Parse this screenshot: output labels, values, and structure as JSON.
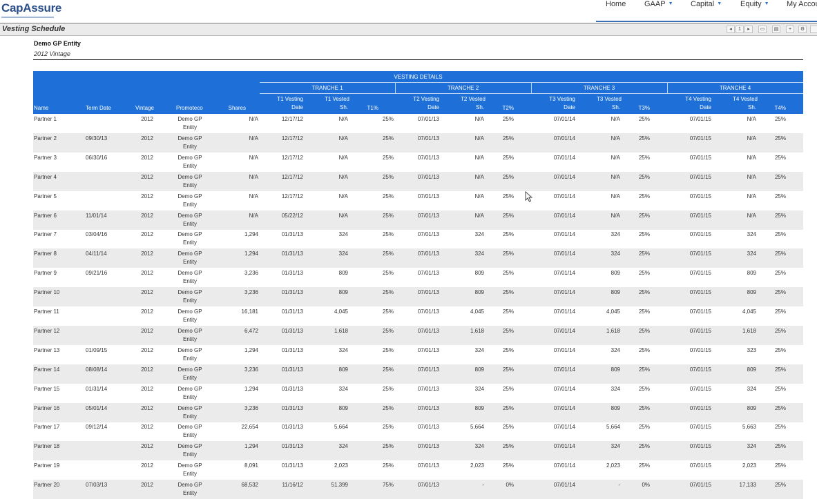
{
  "app": {
    "logo": "CapAssure"
  },
  "nav": [
    {
      "label": "Home",
      "dropdown": false
    },
    {
      "label": "GAAP",
      "dropdown": true
    },
    {
      "label": "Capital",
      "dropdown": true
    },
    {
      "label": "Equity",
      "dropdown": true
    },
    {
      "label": "My Accou",
      "dropdown": false
    }
  ],
  "report": {
    "title": "Vesting Schedule",
    "entity": "Demo GP Entity",
    "vintage_label": "2012 Vintage",
    "toolbar": {
      "first": "◂",
      "page": "1",
      "next": "▸",
      "print": "▭",
      "export": "▤",
      "zoom": "+",
      "settings": "⚙"
    }
  },
  "table": {
    "group_header": "VESTING DETAILS",
    "tranches": [
      "TRANCHE 1",
      "TRANCHE 2",
      "TRANCHE 3",
      "TRANCHE 4"
    ],
    "columns": {
      "name": "Name",
      "term": "Term Date",
      "vintage": "Vintage",
      "promoteco": "Promoteco",
      "shares": "Shares",
      "t1_date": [
        "T1 Vesting",
        "Date"
      ],
      "t1_sh": [
        "T1 Vested",
        "Sh."
      ],
      "t1_pct": "T1%",
      "t2_date": [
        "T2 Vesting",
        "Date"
      ],
      "t2_sh": [
        "T2 Vested",
        "Sh."
      ],
      "t2_pct": "T2%",
      "t3_date": [
        "T3 Vesting",
        "Date"
      ],
      "t3_sh": [
        "T3 Vested",
        "Sh."
      ],
      "t3_pct": "T3%",
      "t4_date": [
        "T4 Vesting",
        "Date"
      ],
      "t4_sh": [
        "T4 Vested",
        "Sh."
      ],
      "t4_pct": "T4%"
    },
    "promoteco_lines": [
      "Demo GP",
      "Entity"
    ],
    "rows": [
      {
        "name": "Partner 1",
        "term": "",
        "vintage": "2012",
        "shares": "N/A",
        "t1_date": "12/17/12",
        "t1_sh": "N/A",
        "t1_pct": "25%",
        "t2_date": "07/01/13",
        "t2_sh": "N/A",
        "t2_pct": "25%",
        "t3_date": "07/01/14",
        "t3_sh": "N/A",
        "t3_pct": "25%",
        "t4_date": "07/01/15",
        "t4_sh": "N/A",
        "t4_pct": "25%"
      },
      {
        "name": "Partner 2",
        "term": "09/30/13",
        "vintage": "2012",
        "shares": "N/A",
        "t1_date": "12/17/12",
        "t1_sh": "N/A",
        "t1_pct": "25%",
        "t2_date": "07/01/13",
        "t2_sh": "N/A",
        "t2_pct": "25%",
        "t3_date": "07/01/14",
        "t3_sh": "N/A",
        "t3_pct": "25%",
        "t4_date": "07/01/15",
        "t4_sh": "N/A",
        "t4_pct": "25%"
      },
      {
        "name": "Partner 3",
        "term": "06/30/16",
        "vintage": "2012",
        "shares": "N/A",
        "t1_date": "12/17/12",
        "t1_sh": "N/A",
        "t1_pct": "25%",
        "t2_date": "07/01/13",
        "t2_sh": "N/A",
        "t2_pct": "25%",
        "t3_date": "07/01/14",
        "t3_sh": "N/A",
        "t3_pct": "25%",
        "t4_date": "07/01/15",
        "t4_sh": "N/A",
        "t4_pct": "25%"
      },
      {
        "name": "Partner 4",
        "term": "",
        "vintage": "2012",
        "shares": "N/A",
        "t1_date": "12/17/12",
        "t1_sh": "N/A",
        "t1_pct": "25%",
        "t2_date": "07/01/13",
        "t2_sh": "N/A",
        "t2_pct": "25%",
        "t3_date": "07/01/14",
        "t3_sh": "N/A",
        "t3_pct": "25%",
        "t4_date": "07/01/15",
        "t4_sh": "N/A",
        "t4_pct": "25%"
      },
      {
        "name": "Partner 5",
        "term": "",
        "vintage": "2012",
        "shares": "N/A",
        "t1_date": "12/17/12",
        "t1_sh": "N/A",
        "t1_pct": "25%",
        "t2_date": "07/01/13",
        "t2_sh": "N/A",
        "t2_pct": "25%",
        "t3_date": "07/01/14",
        "t3_sh": "N/A",
        "t3_pct": "25%",
        "t4_date": "07/01/15",
        "t4_sh": "N/A",
        "t4_pct": "25%"
      },
      {
        "name": "Partner 6",
        "term": "11/01/14",
        "vintage": "2012",
        "shares": "N/A",
        "t1_date": "05/22/12",
        "t1_sh": "N/A",
        "t1_pct": "25%",
        "t2_date": "07/01/13",
        "t2_sh": "N/A",
        "t2_pct": "25%",
        "t3_date": "07/01/14",
        "t3_sh": "N/A",
        "t3_pct": "25%",
        "t4_date": "07/01/15",
        "t4_sh": "N/A",
        "t4_pct": "25%"
      },
      {
        "name": "Partner 7",
        "term": "03/04/16",
        "vintage": "2012",
        "shares": "1,294",
        "t1_date": "01/31/13",
        "t1_sh": "324",
        "t1_pct": "25%",
        "t2_date": "07/01/13",
        "t2_sh": "324",
        "t2_pct": "25%",
        "t3_date": "07/01/14",
        "t3_sh": "324",
        "t3_pct": "25%",
        "t4_date": "07/01/15",
        "t4_sh": "324",
        "t4_pct": "25%"
      },
      {
        "name": "Partner 8",
        "term": "04/11/14",
        "vintage": "2012",
        "shares": "1,294",
        "t1_date": "01/31/13",
        "t1_sh": "324",
        "t1_pct": "25%",
        "t2_date": "07/01/13",
        "t2_sh": "324",
        "t2_pct": "25%",
        "t3_date": "07/01/14",
        "t3_sh": "324",
        "t3_pct": "25%",
        "t4_date": "07/01/15",
        "t4_sh": "324",
        "t4_pct": "25%"
      },
      {
        "name": "Partner 9",
        "term": "09/21/16",
        "vintage": "2012",
        "shares": "3,236",
        "t1_date": "01/31/13",
        "t1_sh": "809",
        "t1_pct": "25%",
        "t2_date": "07/01/13",
        "t2_sh": "809",
        "t2_pct": "25%",
        "t3_date": "07/01/14",
        "t3_sh": "809",
        "t3_pct": "25%",
        "t4_date": "07/01/15",
        "t4_sh": "809",
        "t4_pct": "25%"
      },
      {
        "name": "Partner 10",
        "term": "",
        "vintage": "2012",
        "shares": "3,236",
        "t1_date": "01/31/13",
        "t1_sh": "809",
        "t1_pct": "25%",
        "t2_date": "07/01/13",
        "t2_sh": "809",
        "t2_pct": "25%",
        "t3_date": "07/01/14",
        "t3_sh": "809",
        "t3_pct": "25%",
        "t4_date": "07/01/15",
        "t4_sh": "809",
        "t4_pct": "25%"
      },
      {
        "name": "Partner 11",
        "term": "",
        "vintage": "2012",
        "shares": "16,181",
        "t1_date": "01/31/13",
        "t1_sh": "4,045",
        "t1_pct": "25%",
        "t2_date": "07/01/13",
        "t2_sh": "4,045",
        "t2_pct": "25%",
        "t3_date": "07/01/14",
        "t3_sh": "4,045",
        "t3_pct": "25%",
        "t4_date": "07/01/15",
        "t4_sh": "4,045",
        "t4_pct": "25%"
      },
      {
        "name": "Partner 12",
        "term": "",
        "vintage": "2012",
        "shares": "6,472",
        "t1_date": "01/31/13",
        "t1_sh": "1,618",
        "t1_pct": "25%",
        "t2_date": "07/01/13",
        "t2_sh": "1,618",
        "t2_pct": "25%",
        "t3_date": "07/01/14",
        "t3_sh": "1,618",
        "t3_pct": "25%",
        "t4_date": "07/01/15",
        "t4_sh": "1,618",
        "t4_pct": "25%"
      },
      {
        "name": "Partner 13",
        "term": "01/09/15",
        "vintage": "2012",
        "shares": "1,294",
        "t1_date": "01/31/13",
        "t1_sh": "324",
        "t1_pct": "25%",
        "t2_date": "07/01/13",
        "t2_sh": "324",
        "t2_pct": "25%",
        "t3_date": "07/01/14",
        "t3_sh": "324",
        "t3_pct": "25%",
        "t4_date": "07/01/15",
        "t4_sh": "323",
        "t4_pct": "25%"
      },
      {
        "name": "Partner 14",
        "term": "08/08/14",
        "vintage": "2012",
        "shares": "3,236",
        "t1_date": "01/31/13",
        "t1_sh": "809",
        "t1_pct": "25%",
        "t2_date": "07/01/13",
        "t2_sh": "809",
        "t2_pct": "25%",
        "t3_date": "07/01/14",
        "t3_sh": "809",
        "t3_pct": "25%",
        "t4_date": "07/01/15",
        "t4_sh": "809",
        "t4_pct": "25%"
      },
      {
        "name": "Partner 15",
        "term": "01/31/14",
        "vintage": "2012",
        "shares": "1,294",
        "t1_date": "01/31/13",
        "t1_sh": "324",
        "t1_pct": "25%",
        "t2_date": "07/01/13",
        "t2_sh": "324",
        "t2_pct": "25%",
        "t3_date": "07/01/14",
        "t3_sh": "324",
        "t3_pct": "25%",
        "t4_date": "07/01/15",
        "t4_sh": "324",
        "t4_pct": "25%"
      },
      {
        "name": "Partner 16",
        "term": "05/01/14",
        "vintage": "2012",
        "shares": "3,236",
        "t1_date": "01/31/13",
        "t1_sh": "809",
        "t1_pct": "25%",
        "t2_date": "07/01/13",
        "t2_sh": "809",
        "t2_pct": "25%",
        "t3_date": "07/01/14",
        "t3_sh": "809",
        "t3_pct": "25%",
        "t4_date": "07/01/15",
        "t4_sh": "809",
        "t4_pct": "25%"
      },
      {
        "name": "Partner 17",
        "term": "09/12/14",
        "vintage": "2012",
        "shares": "22,654",
        "t1_date": "01/31/13",
        "t1_sh": "5,664",
        "t1_pct": "25%",
        "t2_date": "07/01/13",
        "t2_sh": "5,664",
        "t2_pct": "25%",
        "t3_date": "07/01/14",
        "t3_sh": "5,664",
        "t3_pct": "25%",
        "t4_date": "07/01/15",
        "t4_sh": "5,663",
        "t4_pct": "25%"
      },
      {
        "name": "Partner 18",
        "term": "",
        "vintage": "2012",
        "shares": "1,294",
        "t1_date": "01/31/13",
        "t1_sh": "324",
        "t1_pct": "25%",
        "t2_date": "07/01/13",
        "t2_sh": "324",
        "t2_pct": "25%",
        "t3_date": "07/01/14",
        "t3_sh": "324",
        "t3_pct": "25%",
        "t4_date": "07/01/15",
        "t4_sh": "324",
        "t4_pct": "25%"
      },
      {
        "name": "Partner 19",
        "term": "",
        "vintage": "2012",
        "shares": "8,091",
        "t1_date": "01/31/13",
        "t1_sh": "2,023",
        "t1_pct": "25%",
        "t2_date": "07/01/13",
        "t2_sh": "2,023",
        "t2_pct": "25%",
        "t3_date": "07/01/14",
        "t3_sh": "2,023",
        "t3_pct": "25%",
        "t4_date": "07/01/15",
        "t4_sh": "2,023",
        "t4_pct": "25%"
      },
      {
        "name": "Partner 20",
        "term": "07/03/13",
        "vintage": "2012",
        "shares": "68,532",
        "t1_date": "11/16/12",
        "t1_sh": "51,399",
        "t1_pct": "75%",
        "t2_date": "07/01/13",
        "t2_sh": "-",
        "t2_pct": "0%",
        "t3_date": "07/01/14",
        "t3_sh": "-",
        "t3_pct": "0%",
        "t4_date": "07/01/15",
        "t4_sh": "17,133",
        "t4_pct": "25%"
      }
    ]
  }
}
